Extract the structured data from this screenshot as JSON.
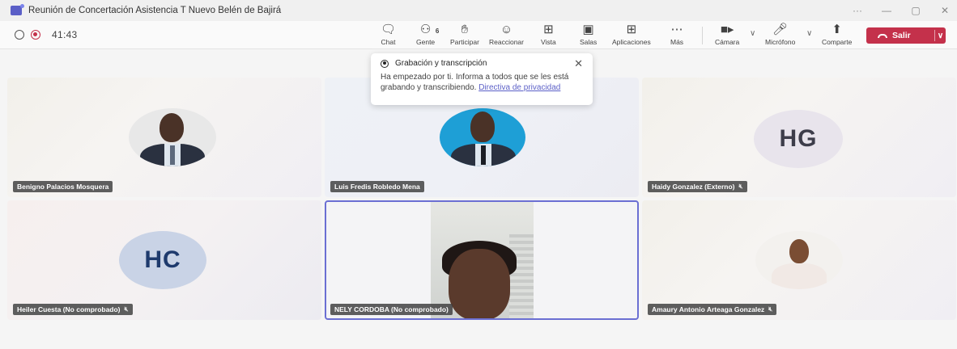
{
  "window": {
    "title": "Reunión de Concertación Asistencia T Nuevo Belén de Bajirá",
    "controls": [
      "···",
      "—",
      "▢",
      "✕"
    ]
  },
  "meeting": {
    "timer": "41:43",
    "toolbar": {
      "chat": "Chat",
      "people": "Gente",
      "people_count": "6",
      "raise_hand": "Participar",
      "react": "Reaccionar",
      "view": "Vista",
      "rooms": "Salas",
      "apps": "Aplicaciones",
      "more": "Más",
      "camera": "Cámara",
      "mic": "Micrófono",
      "share": "Comparte",
      "leave": "Salir"
    }
  },
  "notification": {
    "title": "Grabación y transcripción",
    "body": "Ha empezado por ti. Informa a todos que se les está grabando y transcribiendo. ",
    "link": "Directiva de privacidad"
  },
  "participants": [
    {
      "name": "Benigno Palacios Mosquera",
      "muted": false
    },
    {
      "name": "Luis Fredis Robledo Mena",
      "muted": false
    },
    {
      "name": "Haidy Gonzalez (Externo)",
      "initials": "HG",
      "muted": true
    },
    {
      "name": "Heiler Cuesta (No comprobado)",
      "initials": "HC",
      "muted": true
    },
    {
      "name": "NELY CORDOBA (No comprobado)",
      "muted": false
    },
    {
      "name": "Amaury Antonio Arteaga Gonzalez",
      "muted": true
    }
  ],
  "colors": {
    "accent": "#5b5fc7",
    "leave": "#c4314b",
    "hg_avatar_bg": "#e8e4ec",
    "hg_avatar_fg": "#3d3d4a",
    "hc_avatar_bg": "#c9d3e6",
    "hc_avatar_fg": "#1e3a6d"
  }
}
